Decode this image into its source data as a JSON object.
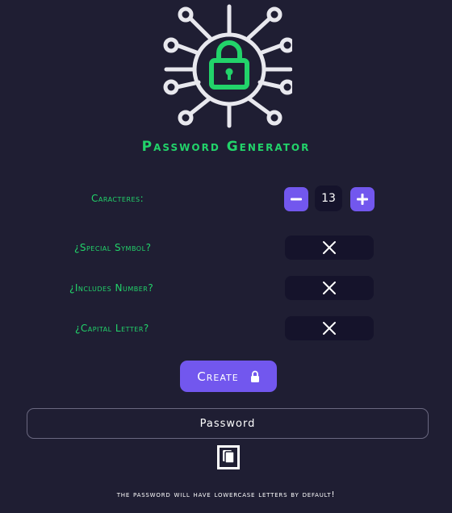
{
  "app": {
    "title": "Password Generator",
    "logo_icon": "circuit-lock-icon"
  },
  "colors": {
    "background": "#1f1e33",
    "accent": "#7257ee",
    "label_green": "#22d36a",
    "field_dark": "#15132b"
  },
  "length": {
    "label": "Caracteres:",
    "value": "13",
    "decrement_icon": "minus-icon",
    "increment_icon": "plus-icon"
  },
  "options": [
    {
      "label": "¿Special Symbol?",
      "state_icon": "x-icon",
      "checked": false
    },
    {
      "label": "¿Includes Number?",
      "state_icon": "x-icon",
      "checked": false
    },
    {
      "label": "¿Capital Letter?",
      "state_icon": "x-icon",
      "checked": false
    }
  ],
  "create": {
    "label": "Create",
    "icon": "lock-icon"
  },
  "output": {
    "placeholder": "Password",
    "value": ""
  },
  "copy": {
    "icon": "copy-icon"
  },
  "footnote": "the password will have lowercase letters by default!"
}
